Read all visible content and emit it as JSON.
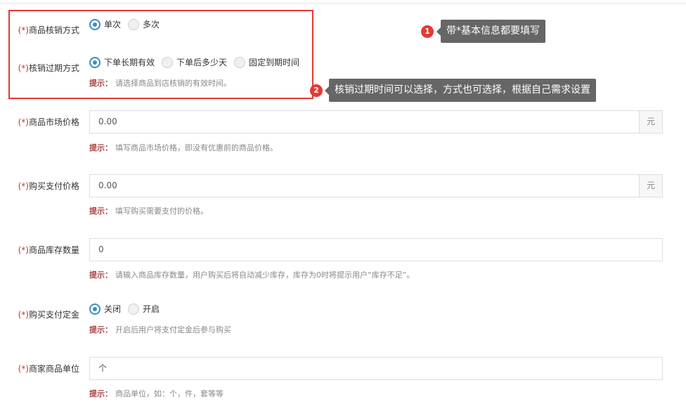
{
  "colors": {
    "accent": "#3c8dbc",
    "required": "#c0392b",
    "hint_label": "#a94442",
    "annotation_red": "#e53935",
    "tooltip_bg": "#666666"
  },
  "form": {
    "verify_mode": {
      "req": "(*)",
      "label": "商品核销方式",
      "options": [
        "单次",
        "多次"
      ],
      "selected": 0
    },
    "expire_mode": {
      "req": "(*)",
      "label": "核销过期方式",
      "options": [
        "下单长期有效",
        "下单后多少天",
        "固定到期时间"
      ],
      "selected": 0,
      "hint_label": "提示：",
      "hint": "请选择商品到店核销的有效时间。"
    },
    "market_price": {
      "req": "(*)",
      "label": "商品市场价格",
      "value": "0.00",
      "addon": "元",
      "hint_label": "提示：",
      "hint": "填写商品市场价格，即没有优惠前的商品价格。"
    },
    "pay_price": {
      "req": "(*)",
      "label": "购买支付价格",
      "value": "0.00",
      "addon": "元",
      "hint_label": "提示：",
      "hint": "填写购买需要支付的价格。"
    },
    "stock": {
      "req": "(*)",
      "label": "商品库存数量",
      "value": "0",
      "hint_label": "提示：",
      "hint": "请输入商品库存数量，用户购买后将自动减少库存，库存为0时将提示用户“库存不足”。"
    },
    "deposit": {
      "req": "(*)",
      "label": "购买支付定金",
      "options": [
        "关闭",
        "开启"
      ],
      "selected": 0,
      "hint_label": "提示：",
      "hint": "开启后用户将支付定金后参与购买"
    },
    "unit": {
      "req": "(*)",
      "label": "商家商品单位",
      "value": "个",
      "hint_label": "提示：",
      "hint": "商品单位，如：个，件，套等等"
    }
  },
  "annotations": {
    "a1": {
      "num": "1",
      "text": "带*基本信息都要填写"
    },
    "a2": {
      "num": "2",
      "text": "核销过期时间可以选择，方式也可选择，根据自己需求设置"
    }
  }
}
